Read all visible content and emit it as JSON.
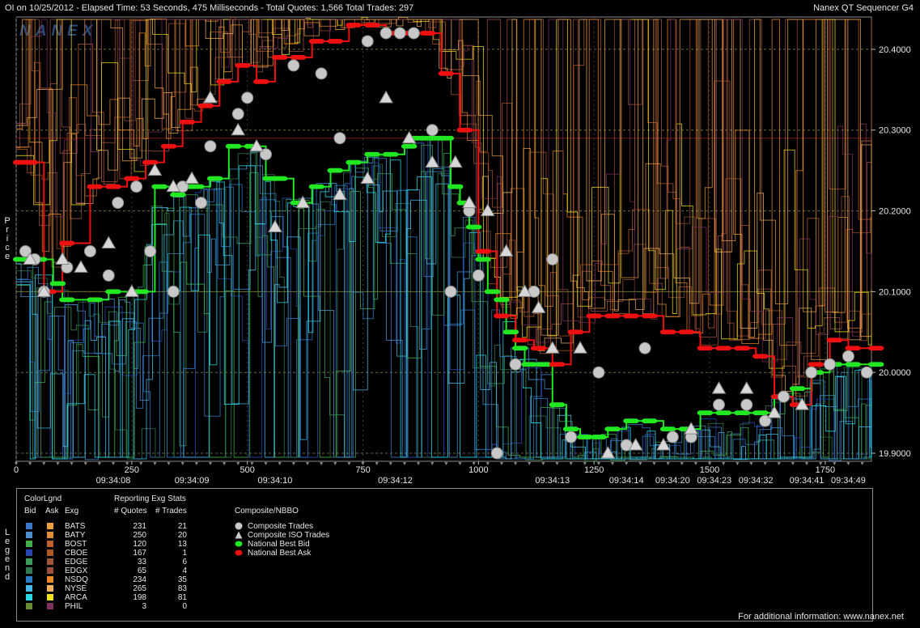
{
  "header": {
    "left": "OI on 10/25/2012  -  Elapsed Time: 53 Seconds, 475 Milliseconds  -  Total Quotes: 1,566  Total Trades: 297",
    "right": "Nanex QT Sequencer G4"
  },
  "watermark": "NANEX",
  "side_labels": {
    "price": "Price",
    "legend": "Legend"
  },
  "chart_data": {
    "type": "line",
    "ylim": [
      19.89,
      20.44
    ],
    "xlim": [
      0,
      1850
    ],
    "y_ticks": [
      "20.4000",
      "20.3000",
      "20.2000",
      "20.1000",
      "20.0000",
      "19.9000"
    ],
    "y_tick_values": [
      20.4,
      20.3,
      20.2,
      20.1,
      20.0,
      19.9
    ],
    "x_ticks": [
      "0",
      "250",
      "500",
      "750",
      "1000",
      "1250",
      "1500",
      "1750"
    ],
    "x_tick_values": [
      0,
      250,
      500,
      750,
      1000,
      1250,
      1500,
      1750
    ],
    "time_labels": [
      "09:34:08",
      "09:34:09",
      "09:34:10",
      "09:34:12",
      "09:34:13",
      "09:34:14",
      "09:34:20",
      "09:34:23",
      "09:34:32",
      "09:34:41",
      "09:34:49"
    ],
    "time_label_x": [
      210,
      380,
      560,
      820,
      1160,
      1320,
      1420,
      1510,
      1600,
      1710,
      1800
    ],
    "reference_lines": [
      20.29,
      20.1
    ],
    "national_best_bid": {
      "x": [
        0,
        40,
        80,
        100,
        160,
        200,
        260,
        300,
        340,
        360,
        380,
        420,
        460,
        500,
        540,
        560,
        600,
        640,
        680,
        720,
        760,
        800,
        840,
        860,
        880,
        900,
        920,
        940,
        960,
        980,
        1000,
        1020,
        1040,
        1060,
        1080,
        1100,
        1130,
        1160,
        1190,
        1220,
        1250,
        1280,
        1320,
        1360,
        1400,
        1440,
        1480,
        1520,
        1560,
        1600,
        1640,
        1680,
        1720,
        1760,
        1800,
        1850
      ],
      "y": [
        20.14,
        20.14,
        20.11,
        20.09,
        20.09,
        20.1,
        20.1,
        20.23,
        20.22,
        20.23,
        20.23,
        20.24,
        20.28,
        20.28,
        20.24,
        20.24,
        20.21,
        20.23,
        20.25,
        20.26,
        20.27,
        20.27,
        20.28,
        20.29,
        20.29,
        20.29,
        20.29,
        20.23,
        20.21,
        20.18,
        20.14,
        20.1,
        20.09,
        20.05,
        20.03,
        20.01,
        20.01,
        19.96,
        19.93,
        19.92,
        19.92,
        19.93,
        19.94,
        19.94,
        19.93,
        19.93,
        19.95,
        19.95,
        19.95,
        19.95,
        19.97,
        19.98,
        20.0,
        20.01,
        20.01,
        20.01
      ]
    },
    "national_best_ask": {
      "x": [
        0,
        20,
        60,
        100,
        160,
        200,
        240,
        280,
        320,
        360,
        400,
        440,
        480,
        520,
        560,
        600,
        640,
        680,
        720,
        760,
        800,
        840,
        880,
        920,
        960,
        1000,
        1040,
        1080,
        1120,
        1160,
        1200,
        1240,
        1280,
        1320,
        1360,
        1400,
        1440,
        1480,
        1520,
        1560,
        1600,
        1640,
        1680,
        1720,
        1760,
        1800,
        1850
      ],
      "y": [
        20.26,
        20.26,
        20.1,
        20.16,
        20.23,
        20.23,
        20.24,
        20.26,
        20.28,
        20.31,
        20.33,
        20.36,
        20.38,
        20.36,
        20.39,
        20.39,
        20.41,
        20.41,
        20.43,
        20.43,
        20.42,
        20.42,
        20.42,
        20.37,
        20.3,
        20.15,
        20.07,
        20.04,
        20.03,
        20.01,
        20.05,
        20.07,
        20.07,
        20.07,
        20.07,
        20.05,
        20.05,
        20.03,
        20.03,
        20.03,
        20.02,
        19.97,
        19.96,
        20.01,
        20.04,
        20.03,
        20.03
      ]
    },
    "composite_trades": {
      "x": [
        20,
        40,
        60,
        110,
        160,
        200,
        220,
        260,
        290,
        340,
        360,
        400,
        420,
        480,
        500,
        540,
        600,
        660,
        700,
        760,
        800,
        830,
        860,
        900,
        940,
        980,
        1000,
        1040,
        1080,
        1120,
        1160,
        1200,
        1260,
        1320,
        1360,
        1420,
        1460,
        1520,
        1580,
        1620,
        1660,
        1720,
        1760,
        1800,
        1840
      ],
      "y": [
        20.15,
        20.14,
        20.1,
        20.13,
        20.15,
        20.12,
        20.21,
        20.23,
        20.15,
        20.1,
        20.23,
        20.21,
        20.28,
        20.32,
        20.34,
        20.27,
        20.38,
        20.37,
        20.29,
        20.41,
        20.42,
        20.42,
        20.42,
        20.3,
        20.1,
        20.2,
        20.12,
        19.9,
        20.01,
        20.1,
        20.14,
        19.92,
        20.0,
        19.91,
        20.03,
        19.92,
        19.92,
        19.96,
        19.96,
        19.94,
        19.97,
        20.0,
        20.01,
        20.02,
        20.0
      ]
    },
    "composite_iso_trades": {
      "x": [
        30,
        60,
        100,
        140,
        200,
        250,
        300,
        340,
        380,
        420,
        480,
        520,
        560,
        620,
        700,
        760,
        800,
        850,
        900,
        950,
        980,
        1020,
        1060,
        1100,
        1130,
        1160,
        1220,
        1280,
        1340,
        1400,
        1460,
        1520,
        1580,
        1640,
        1700
      ],
      "y": [
        20.14,
        20.1,
        20.14,
        20.13,
        20.16,
        20.1,
        20.25,
        20.23,
        20.24,
        20.34,
        20.3,
        20.28,
        20.18,
        20.21,
        20.22,
        20.24,
        20.34,
        20.29,
        20.26,
        20.26,
        20.21,
        20.2,
        20.15,
        20.1,
        20.08,
        20.03,
        20.03,
        19.9,
        19.91,
        19.91,
        19.93,
        19.98,
        19.98,
        19.95,
        19.96
      ]
    }
  },
  "legend": {
    "headers": {
      "colorlgnd": "ColorLgnd",
      "bid": "Bid",
      "ask": "Ask",
      "exg": "Exg",
      "reporting": "Reporting Exg Stats",
      "quotes": "# Quotes",
      "trades": "# Trades",
      "composite": "Composite/NBBO"
    },
    "exchanges": [
      {
        "name": "BATS",
        "quotes": "231",
        "trades": "21",
        "bid_color": "#3a78c8",
        "ask_color": "#e8a040"
      },
      {
        "name": "BATY",
        "quotes": "250",
        "trades": "20",
        "bid_color": "#4a90d0",
        "ask_color": "#e09038"
      },
      {
        "name": "BOST",
        "quotes": "120",
        "trades": "13",
        "bid_color": "#3fae4a",
        "ask_color": "#c06030"
      },
      {
        "name": "CBOE",
        "quotes": "167",
        "trades": "1",
        "bid_color": "#2848b0",
        "ask_color": "#b05828"
      },
      {
        "name": "EDGE",
        "quotes": "33",
        "trades": "6",
        "bid_color": "#3c9a5a",
        "ask_color": "#a05838"
      },
      {
        "name": "EDGX",
        "quotes": "65",
        "trades": "4",
        "bid_color": "#307850",
        "ask_color": "#9c5040"
      },
      {
        "name": "NSDQ",
        "quotes": "234",
        "trades": "35",
        "bid_color": "#2c7cc8",
        "ask_color": "#e88828"
      },
      {
        "name": "NYSE",
        "quotes": "265",
        "trades": "83",
        "bid_color": "#48b8e8",
        "ask_color": "#f0b060"
      },
      {
        "name": "ARCA",
        "quotes": "198",
        "trades": "81",
        "bid_color": "#28d8e8",
        "ask_color": "#f0e020"
      },
      {
        "name": "PHIL",
        "quotes": "3",
        "trades": "0",
        "bid_color": "#6a8a30",
        "ask_color": "#803060"
      }
    ],
    "composite": [
      {
        "label": "Composite Trades",
        "symbol": "circle",
        "color": "#c8c8c8"
      },
      {
        "label": "Composite ISO Trades",
        "symbol": "triangle",
        "color": "#c8c8c8"
      },
      {
        "label": "National Best Bid",
        "symbol": "dot",
        "color": "#22e822"
      },
      {
        "label": "National Best Ask",
        "symbol": "dot",
        "color": "#ee1010"
      }
    ]
  },
  "footer": "For additional information: www.nanex.net"
}
